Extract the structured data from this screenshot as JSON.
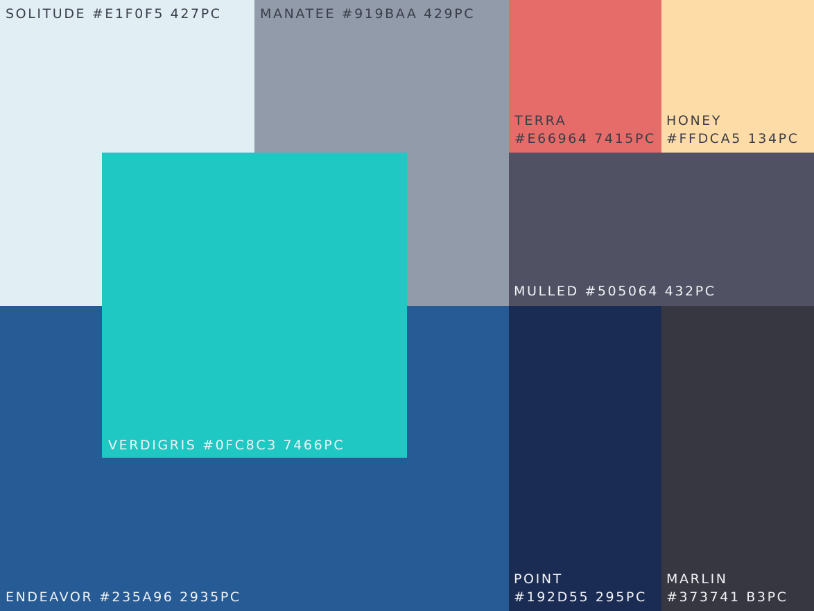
{
  "swatches": {
    "solitude": {
      "name": "SOLITUDE",
      "line1": "SOLITUDE #E1F0F5 427PC",
      "line2": "",
      "color": "#E1EFF5"
    },
    "manatee": {
      "name": "MANATEE",
      "line1": "MANATEE #919BAA 429PC",
      "line2": "",
      "color": "#929BAA"
    },
    "terra": {
      "name": "TERRA",
      "line1": "TERRA",
      "line2": "#E66964 7415PC",
      "color": "#E66C69"
    },
    "honey": {
      "name": "HONEY",
      "line1": "HONEY",
      "line2": "#FFDCA5 134PC",
      "color": "#FEDCA7"
    },
    "mulled": {
      "name": "MULLED",
      "line1": "MULLED #505064 432PC",
      "line2": "",
      "color": "#505163"
    },
    "endeavor": {
      "name": "ENDEAVOR",
      "line1": "ENDEAVOR #235A96 2935PC",
      "line2": "",
      "color": "#265B95"
    },
    "point": {
      "name": "POINT",
      "line1": "POINT",
      "line2": "#192D55 295PC",
      "color": "#1B2C54"
    },
    "marlin": {
      "name": "MARLIN",
      "line1": "MARLIN",
      "line2": "#373741 B3PC",
      "color": "#373741"
    },
    "verdigris": {
      "name": "VERDIGRIS",
      "line1": "VERDIGRIS #0FC8C3 7466PC",
      "line2": "",
      "color": "#1FC8C3"
    }
  }
}
